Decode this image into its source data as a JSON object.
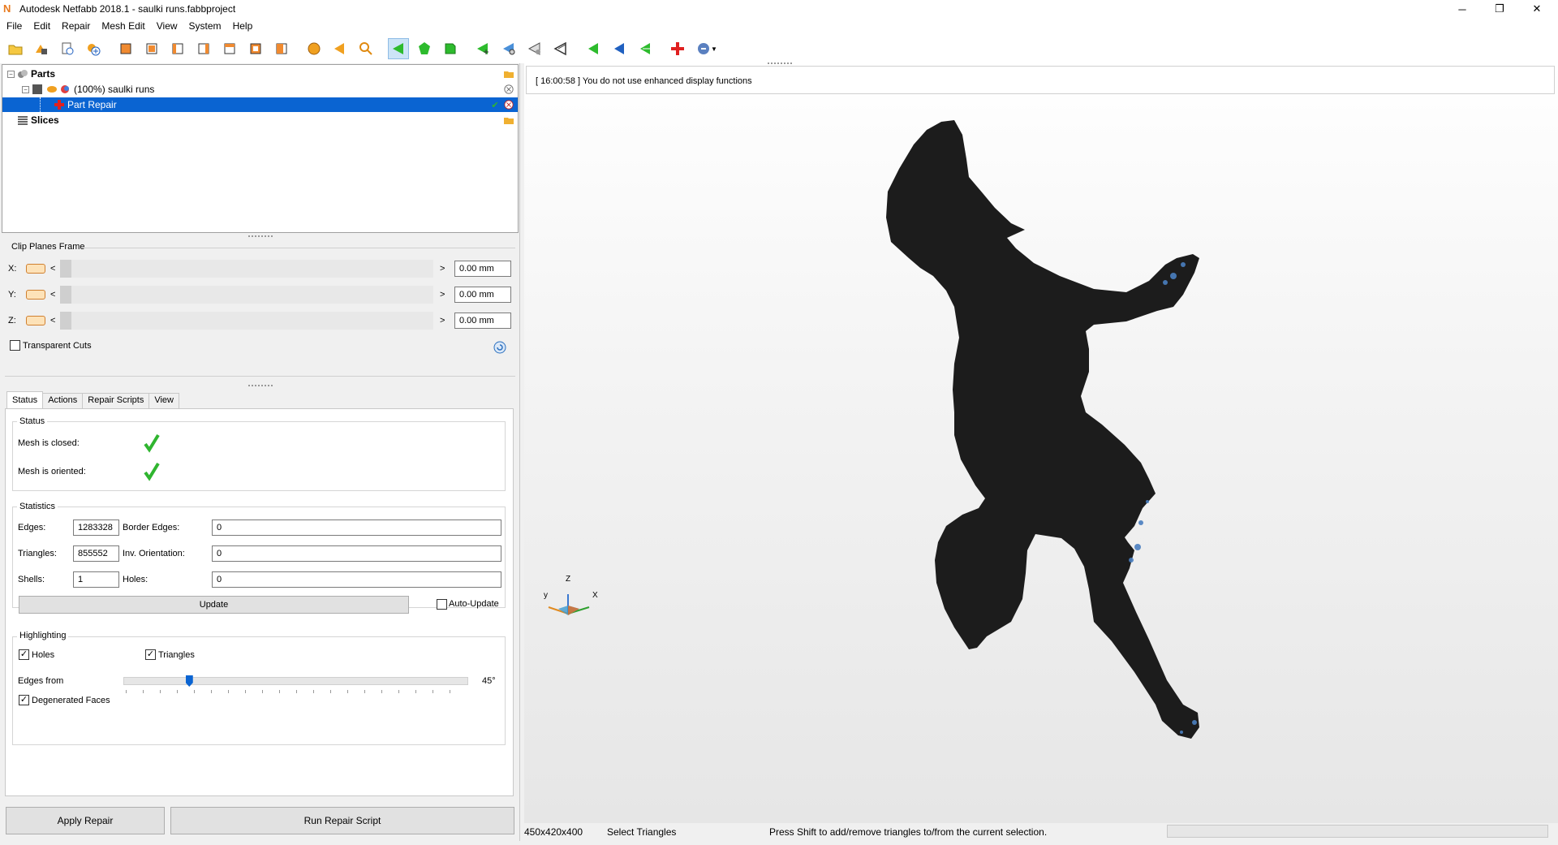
{
  "window": {
    "title": "Autodesk Netfabb 2018.1 - saulki runs.fabbproject",
    "app_logo": "N",
    "controls": {
      "minimize": "─",
      "maximize": "❐",
      "close": "✕"
    }
  },
  "menu": [
    "File",
    "Edit",
    "Repair",
    "Mesh Edit",
    "View",
    "System",
    "Help"
  ],
  "toolbar_icons": [
    "open-project-icon",
    "add-part-icon",
    "new-part-icon",
    "add-plus-icon",
    "view-front-icon",
    "view-back-icon",
    "view-left-icon",
    "view-right-icon",
    "view-top-icon",
    "view-bottom-icon",
    "view-iso-icon",
    "sphere-icon",
    "arrow-left-orange-icon",
    "zoom-icon",
    "select-triangle-icon",
    "select-surface-icon",
    "select-shell-icon",
    "add-triangle-icon",
    "triangle-edit-icon",
    "triangle-remove-icon",
    "triangle-split-icon",
    "arrow-green-icon",
    "arrow-blue-icon",
    "arrow-green-back-icon",
    "repair-cross-icon",
    "help-dropdown-icon"
  ],
  "tree": {
    "parts_label": "Parts",
    "project_label": "(100%) saulki runs",
    "repair_label": "Part Repair",
    "slices_label": "Slices"
  },
  "clip": {
    "title": "Clip Planes Frame",
    "rows": [
      {
        "axis": "X:",
        "left": "<",
        "right": ">",
        "value": "0.00 mm"
      },
      {
        "axis": "Y:",
        "left": "<",
        "right": ">",
        "value": "0.00 mm"
      },
      {
        "axis": "Z:",
        "left": "<",
        "right": ">",
        "value": "0.00 mm"
      }
    ],
    "transparent_label": "Transparent Cuts"
  },
  "tabs": [
    "Status",
    "Actions",
    "Repair Scripts",
    "View"
  ],
  "status": {
    "title": "Status",
    "closed_label": "Mesh is closed:",
    "oriented_label": "Mesh is oriented:"
  },
  "stats": {
    "title": "Statistics",
    "edges_label": "Edges:",
    "edges": "1283328",
    "border_edges_label": "Border Edges:",
    "border_edges": "0",
    "triangles_label": "Triangles:",
    "triangles": "855552",
    "inv_orientation_label": "Inv. Orientation:",
    "inv_orientation": "0",
    "shells_label": "Shells:",
    "shells": "1",
    "holes_label": "Holes:",
    "holes": "0",
    "update_label": "Update",
    "auto_update_label": "Auto-Update"
  },
  "highlight": {
    "title": "Highlighting",
    "holes_label": "Holes",
    "triangles_label": "Triangles",
    "edges_label": "Edges from",
    "edges_value": "45°",
    "edges_fraction": 0.19,
    "degenerated_label": "Degenerated Faces",
    "check": "✓"
  },
  "buttons": {
    "apply_repair": "Apply Repair",
    "run_script": "Run Repair Script"
  },
  "viewport": {
    "log": "[ 16:00:58 ] You do not use enhanced display functions",
    "axis_z": "Z",
    "axis_x": "X",
    "axis_y": "y"
  },
  "statusbar": {
    "size": "450x420x400",
    "mode": "Select Triangles",
    "hint": "Press Shift to add/remove triangles to/from the current selection."
  },
  "colors": {
    "selection": "#0a64d2",
    "model": "#1c1c1c",
    "check_green": "#2fb52f"
  }
}
